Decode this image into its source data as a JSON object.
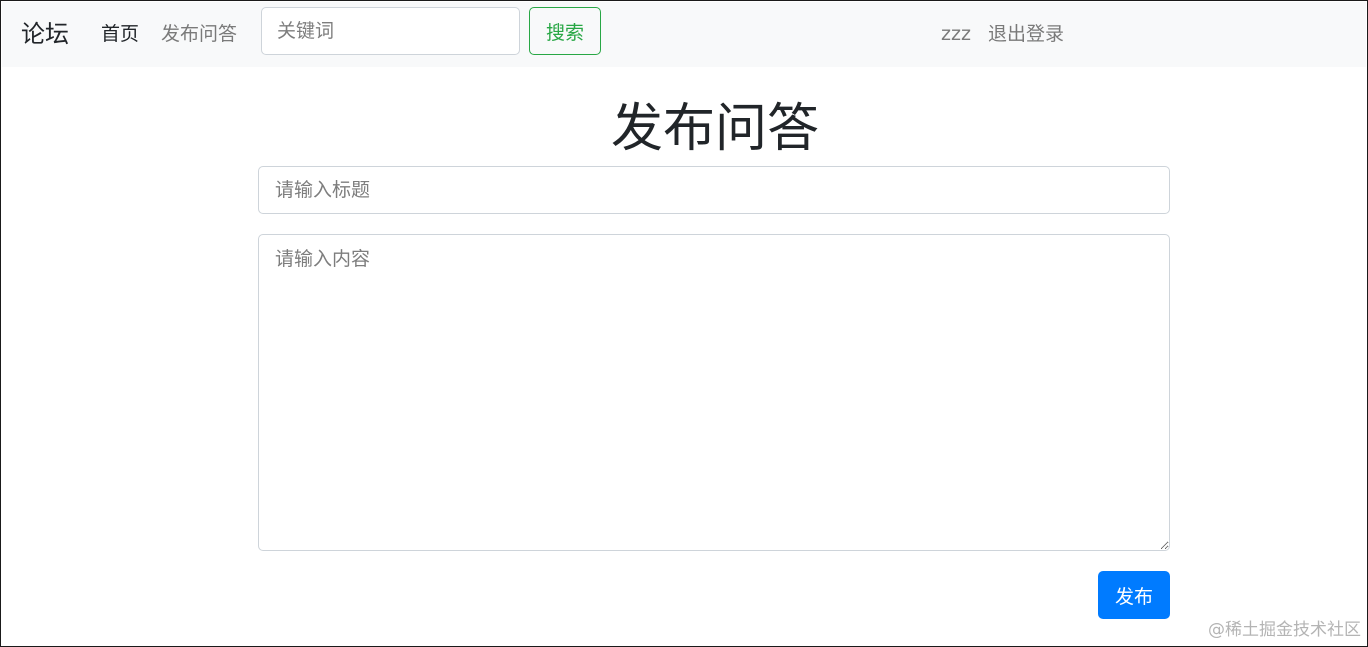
{
  "navbar": {
    "brand": "论坛",
    "links": {
      "home": "首页",
      "post": "发布问答"
    },
    "search": {
      "placeholder": "关键词",
      "value": "",
      "button_label": "搜索"
    },
    "user": {
      "name": "zzz",
      "logout": "退出登录"
    }
  },
  "main": {
    "title": "发布问答",
    "title_field": {
      "placeholder": "请输入标题",
      "value": ""
    },
    "content_field": {
      "placeholder": "请输入内容",
      "value": ""
    },
    "submit_label": "发布"
  },
  "watermark": "@稀土掘金技术社区",
  "colors": {
    "navbar_bg": "#f8f9fa",
    "search_button": "#28a745",
    "primary_button": "#007bff",
    "muted_text": "#7a7a7a"
  }
}
